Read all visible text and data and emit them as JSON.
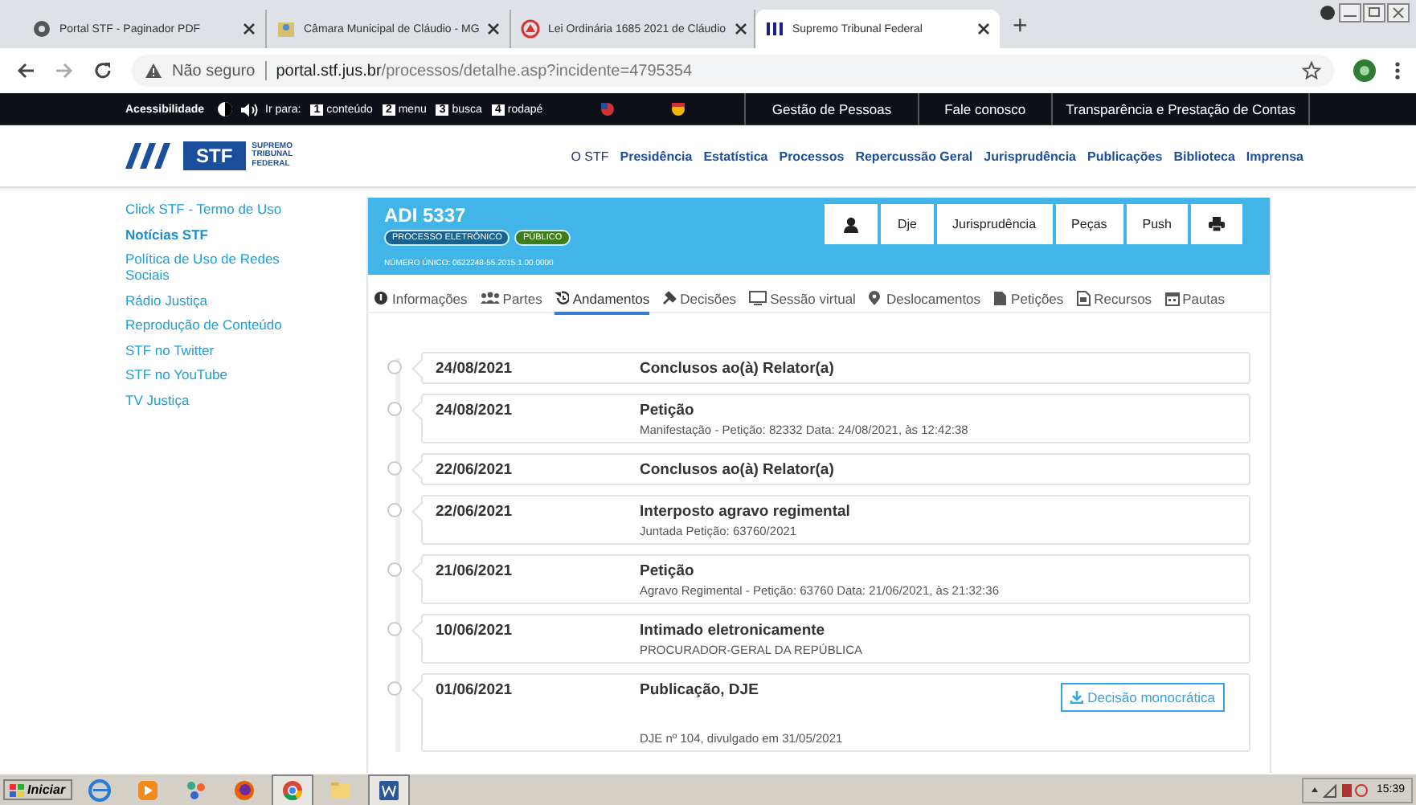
{
  "browser": {
    "tabs": [
      {
        "title": "Portal STF - Paginador PDF",
        "selected": false
      },
      {
        "title": "Câmara Municipal de Cláudio - MG",
        "selected": false
      },
      {
        "title": "Lei Ordinária 1685 2021 de Cláudio",
        "selected": false
      },
      {
        "title": "Supremo Tribunal Federal",
        "selected": true
      }
    ],
    "new_tab": "+",
    "security": "Não seguro",
    "url_host": "portal.stf.jus.br",
    "url_path": "/processos/detalhe.asp?incidente=4795354"
  },
  "top_bar": {
    "accessibility": "Acessibilidade",
    "go_to": "Ir para:",
    "shortcuts": [
      {
        "key": "1",
        "label": "conteúdo"
      },
      {
        "key": "2",
        "label": "menu"
      },
      {
        "key": "3",
        "label": "busca"
      },
      {
        "key": "4",
        "label": "rodapé"
      }
    ],
    "links": [
      "Gestão de Pessoas",
      "Fale conosco",
      "Transparência e Prestação de Contas"
    ]
  },
  "site": {
    "logo": "STF",
    "logo_caption": "SUPREMO TRIBUNAL FEDERAL",
    "nav": [
      "O STF",
      "Presidência",
      "Estatística",
      "Processos",
      "Repercussão Geral",
      "Jurisprudência",
      "Publicações",
      "Biblioteca",
      "Imprensa"
    ]
  },
  "sidebar": {
    "items": [
      {
        "label": "Click STF - Termo de Uso",
        "kind": "link"
      },
      {
        "label": "Notícias STF",
        "kind": "heading"
      },
      {
        "label": "Política de Uso de Redes Sociais",
        "kind": "link"
      },
      {
        "label": "Rádio Justiça",
        "kind": "link"
      },
      {
        "label": "Reprodução de Conteúdo",
        "kind": "link"
      },
      {
        "label": "STF no Twitter",
        "kind": "link"
      },
      {
        "label": "STF no YouTube",
        "kind": "link"
      },
      {
        "label": "TV Justiça",
        "kind": "link"
      }
    ]
  },
  "process": {
    "title": "ADI 5337",
    "badges": [
      {
        "label": "PROCESSO ELETRÔNICO",
        "kind": "type"
      },
      {
        "label": "PÚBLICO",
        "kind": "access"
      }
    ],
    "number": "NÚMERO ÚNICO: 0622248-55.2015.1.00.0000",
    "buttons": [
      "Dje",
      "Jurisprudência",
      "Peças",
      "Push"
    ],
    "tabs": [
      {
        "label": "Informações",
        "selected": false
      },
      {
        "label": "Partes",
        "selected": false
      },
      {
        "label": "Andamentos",
        "selected": true
      },
      {
        "label": "Decisões",
        "selected": false
      },
      {
        "label": "Sessão virtual",
        "selected": false
      },
      {
        "label": "Deslocamentos",
        "selected": false
      },
      {
        "label": "Petições",
        "selected": false
      },
      {
        "label": "Recursos",
        "selected": false
      },
      {
        "label": "Pautas",
        "selected": false
      }
    ],
    "events": [
      {
        "date": "24/08/2021",
        "title": "Conclusos ao(à) Relator(a)"
      },
      {
        "date": "24/08/2021",
        "title": "Petição",
        "detail": "Manifestação - Petição: 82332 Data: 24/08/2021, às 12:42:38"
      },
      {
        "date": "22/06/2021",
        "title": "Conclusos ao(à) Relator(a)"
      },
      {
        "date": "22/06/2021",
        "title": "Interposto agravo regimental",
        "detail": "Juntada Petição: 63760/2021"
      },
      {
        "date": "21/06/2021",
        "title": "Petição",
        "detail": "Agravo Regimental - Petição: 63760 Data: 21/06/2021, às 21:32:36"
      },
      {
        "date": "10/06/2021",
        "title": "Intimado eletronicamente",
        "detail": "PROCURADOR-GERAL DA REPÚBLICA"
      },
      {
        "date": "01/06/2021",
        "title": "Publicação, DJE",
        "detail": "DJE nº 104, divulgado em 31/05/2021",
        "action": "Decisão monocrática"
      }
    ]
  },
  "taskbar": {
    "start": "Iniciar",
    "clock": "15:39"
  }
}
